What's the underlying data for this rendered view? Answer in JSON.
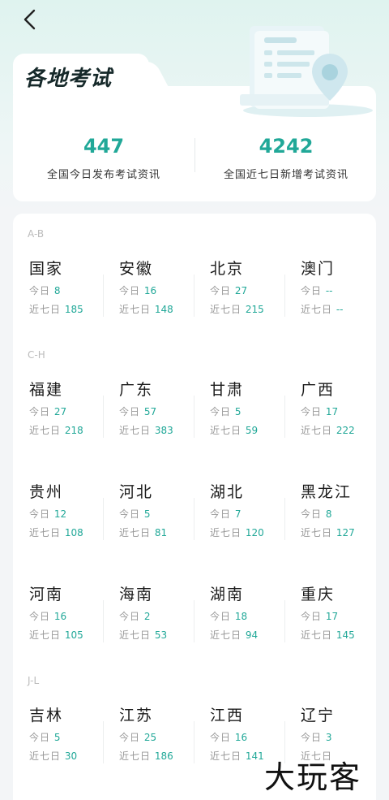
{
  "page": {
    "title": "各地考试"
  },
  "stats": [
    {
      "value": "447",
      "label": "全国今日发布考试资讯"
    },
    {
      "value": "4242",
      "label": "全国近七日新增考试资讯"
    }
  ],
  "labels": {
    "today": "今日",
    "week": "近七日"
  },
  "colors": {
    "accent": "#21a898",
    "title": "#16292a"
  },
  "groups": [
    {
      "letter": "A-B",
      "regions": [
        {
          "name": "国家",
          "today": "8",
          "week": "185"
        },
        {
          "name": "安徽",
          "today": "16",
          "week": "148"
        },
        {
          "name": "北京",
          "today": "27",
          "week": "215"
        },
        {
          "name": "澳门",
          "today": "--",
          "week": "--"
        }
      ]
    },
    {
      "letter": "C-H",
      "regions": [
        {
          "name": "福建",
          "today": "27",
          "week": "218"
        },
        {
          "name": "广东",
          "today": "57",
          "week": "383"
        },
        {
          "name": "甘肃",
          "today": "5",
          "week": "59"
        },
        {
          "name": "广西",
          "today": "17",
          "week": "222"
        },
        {
          "name": "贵州",
          "today": "12",
          "week": "108"
        },
        {
          "name": "河北",
          "today": "5",
          "week": "81"
        },
        {
          "name": "湖北",
          "today": "7",
          "week": "120"
        },
        {
          "name": "黑龙江",
          "today": "8",
          "week": "127"
        },
        {
          "name": "河南",
          "today": "16",
          "week": "105"
        },
        {
          "name": "海南",
          "today": "2",
          "week": "53"
        },
        {
          "name": "湖南",
          "today": "18",
          "week": "94"
        },
        {
          "name": "重庆",
          "today": "17",
          "week": "145"
        }
      ]
    },
    {
      "letter": "J-L",
      "regions": [
        {
          "name": "吉林",
          "today": "5",
          "week": "30"
        },
        {
          "name": "江苏",
          "today": "25",
          "week": "186"
        },
        {
          "name": "江西",
          "today": "16",
          "week": "141"
        },
        {
          "name": "辽宁",
          "today": "3",
          "week": ""
        }
      ]
    }
  ],
  "watermark": "大玩客"
}
